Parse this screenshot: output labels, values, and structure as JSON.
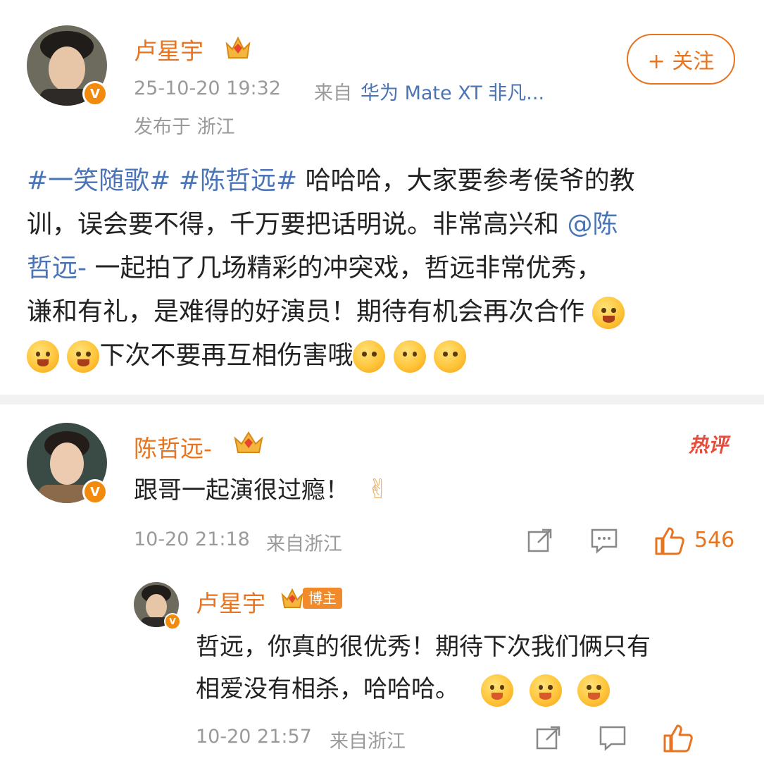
{
  "post": {
    "author": "卢星宇",
    "time": "25-10-20 19:32",
    "source_prefix": "来自",
    "source_device": "华为 Mate XT 非凡...",
    "location": "发布于 浙江",
    "follow_label": "+ 关注",
    "text_parts": [
      {
        "text": "#一笑随歌#",
        "kind": "link"
      },
      {
        "text": " ",
        "kind": "plain"
      },
      {
        "text": "#陈哲远#",
        "kind": "link"
      },
      {
        "text": " 哈哈哈，大家要参考侯爷的教训，误会要不得，千万要把话明说。非常高兴和 ",
        "kind": "plain"
      },
      {
        "text": "@陈哲远-",
        "kind": "link"
      },
      {
        "text": " 一起拍了几场精彩的冲突戏，哲远非常优秀，谦和有礼，是难得的好演员！期待有机会再次合作",
        "kind": "plain"
      }
    ],
    "line1_rest": " 哈哈哈，大家要参考侯爷的教",
    "line2": "训，误会要不得，千万要把话明说。非常高兴和 ",
    "line2_link": "@陈",
    "line3_link": "哲远-",
    "line3": " 一起拍了几场精彩的冲突戏，哲远非常优秀，",
    "line4": "谦和有礼，是难得的好演员！期待有机会再次合作",
    "line5": "下次不要再互相伤害哦",
    "tag1": "#一笑随歌#",
    "tag2": "#陈哲远#"
  },
  "comment": {
    "author": "陈哲远-",
    "hot_badge": "热评",
    "text": "跟哥一起演很过瘾！",
    "emoji": "✌",
    "time": "10-20 21:18",
    "location": "来自浙江",
    "likes": "546"
  },
  "reply": {
    "author": "卢星宇",
    "badge": "博主",
    "line1": "哲远，你真的很优秀！期待下次我们俩只有",
    "line2": "相爱没有相杀，哈哈哈。",
    "time": "10-20 21:57",
    "location": "来自浙江"
  },
  "icons": {
    "verified": "V",
    "share": "↗",
    "comment": "⋯",
    "like": "👍"
  },
  "colors": {
    "accent": "#e8741f",
    "link": "#4a74b6",
    "meta": "#9a9a9a",
    "hot": "#e84b3c"
  }
}
